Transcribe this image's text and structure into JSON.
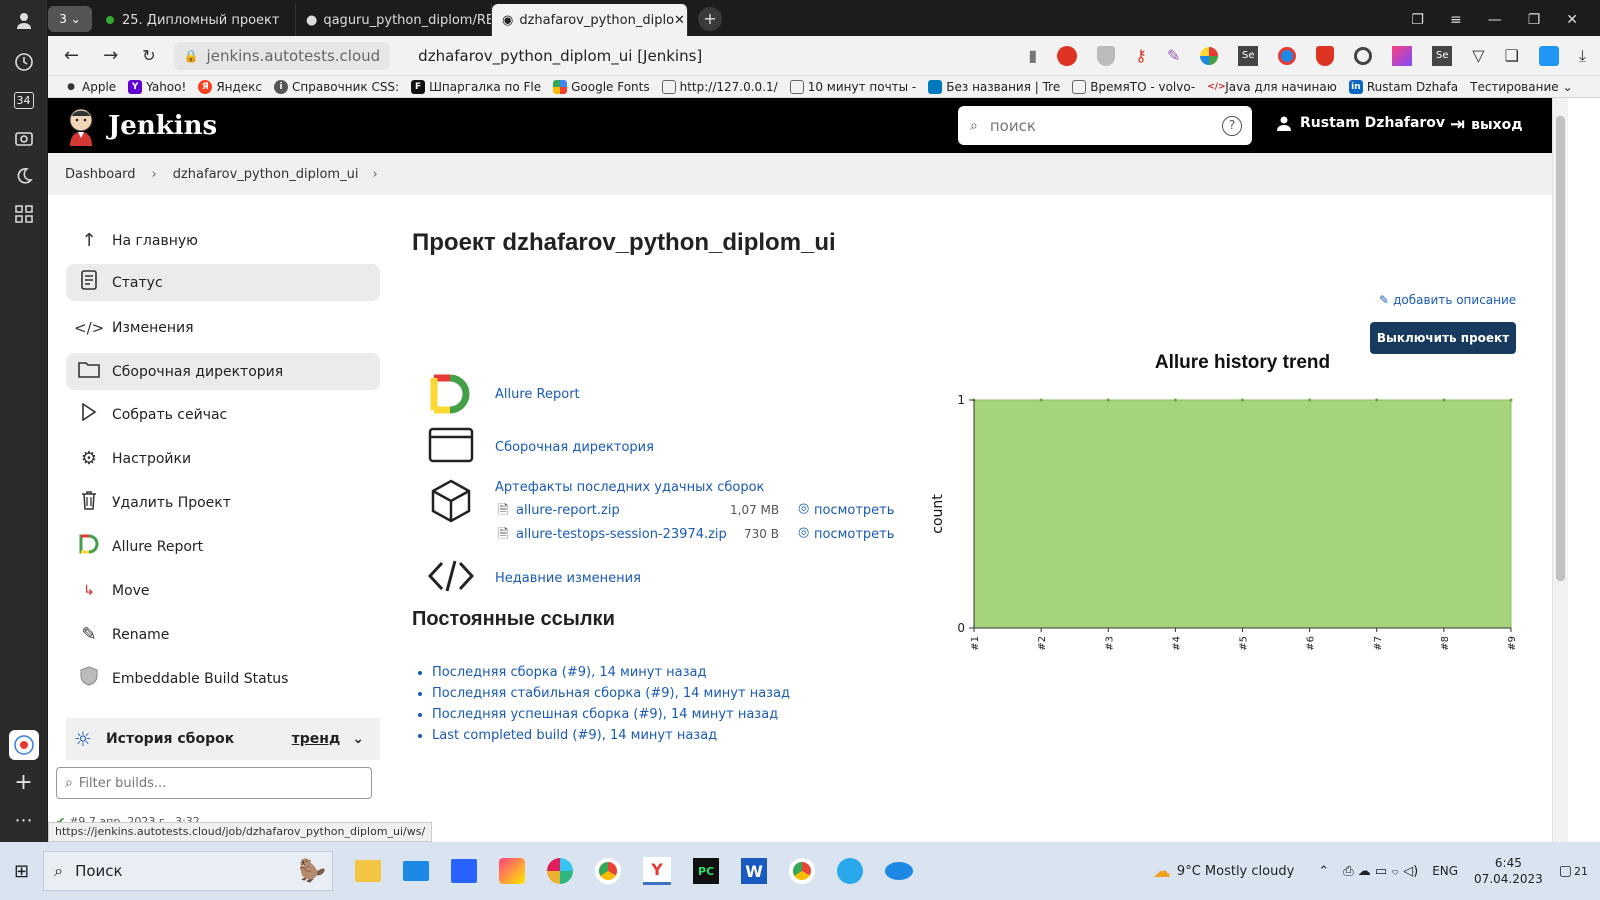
{
  "browser": {
    "sidebar_badge": "34",
    "tabs": [
      {
        "label": "3"
      },
      {
        "label": "25. Дипломный проект"
      },
      {
        "label": "qaguru_python_diplom/RE"
      },
      {
        "label": "dzhafarov_python_diplo"
      }
    ],
    "address_domain": "jenkins.autotests.cloud",
    "page_title": "dzhafarov_python_diplom_ui [Jenkins]",
    "bookmarks": [
      "Apple",
      "Yahoo!",
      "Яндекс",
      "Справочник CSS:",
      "Шпаргалка по Fle",
      "Google Fonts",
      "http://127.0.0.1/",
      "10 минут почты -",
      "Без названия | Tre",
      "ВремяТО - volvo-",
      "Java для начинаю",
      "Rustam Dzhafa",
      "Тестирование"
    ],
    "status_url": "https://jenkins.autotests.cloud/job/dzhafarov_python_diplom_ui/ws/"
  },
  "header": {
    "brand": "Jenkins",
    "search_placeholder": "поиск",
    "user": "Rustam Dzhafarov",
    "logout": "выход"
  },
  "breadcrumb": [
    "Dashboard",
    "dzhafarov_python_diplom_ui"
  ],
  "sidebar": {
    "items": [
      {
        "label": "На главную",
        "icon": "arrow-up-icon"
      },
      {
        "label": "Статус",
        "icon": "document-icon"
      },
      {
        "label": "Изменения",
        "icon": "code-icon"
      },
      {
        "label": "Сборочная директория",
        "icon": "folder-icon"
      },
      {
        "label": "Собрать сейчас",
        "icon": "play-icon"
      },
      {
        "label": "Настройки",
        "icon": "gear-icon"
      },
      {
        "label": "Удалить Проект",
        "icon": "trash-icon"
      },
      {
        "label": "Allure Report",
        "icon": "allure-icon"
      },
      {
        "label": "Move",
        "icon": "move-icon"
      },
      {
        "label": "Rename",
        "icon": "pencil-icon"
      },
      {
        "label": "Embeddable Build Status",
        "icon": "shield-icon"
      }
    ],
    "history_title": "История сборок",
    "trend_label": "тренд",
    "filter_placeholder": "Filter builds...",
    "build_row_partial": "#9       7 апр. 2023 г., 3:32"
  },
  "main": {
    "title": "Проект dzhafarov_python_diplom_ui",
    "add_description": "добавить описание",
    "disable_button": "Выключить проект",
    "links": {
      "allure": "Allure Report",
      "workspace": "Сборочная директория",
      "artifacts": "Артефакты последних удачных сборок",
      "recent_changes": "Недавние изменения"
    },
    "artifacts": [
      {
        "name": "allure-report.zip",
        "size": "1,07 MB",
        "view": "посмотреть"
      },
      {
        "name": "allure-testops-session-23974.zip",
        "size": "730 B",
        "view": "посмотреть"
      }
    ],
    "permalinks_title": "Постоянные ссылки",
    "permalinks": [
      "Последняя сборка (#9), 14 минут назад",
      "Последняя стабильная сборка (#9), 14 минут назад",
      "Последняя успешная сборка (#9), 14 минут назад",
      "Last completed build (#9), 14 минут назад"
    ]
  },
  "chart_data": {
    "type": "area",
    "title": "Allure history trend",
    "xlabel": "",
    "ylabel": "count",
    "categories": [
      "#1",
      "#2",
      "#3",
      "#4",
      "#5",
      "#6",
      "#7",
      "#8",
      "#9"
    ],
    "series": [
      {
        "values": [
          1,
          1,
          1,
          1,
          1,
          1,
          1,
          1,
          1
        ],
        "color": "#a5d47a"
      }
    ],
    "ylim": [
      0,
      1
    ],
    "yticks": [
      "1",
      "0"
    ]
  },
  "taskbar": {
    "search": "Поиск",
    "weather": "9°C  Mostly cloudy",
    "lang": "ENG",
    "time": "6:45",
    "date": "07.04.2023",
    "notif": "21"
  },
  "colors": {
    "accent": "#1a5ab4",
    "button_bg": "#173a5e",
    "chart_fill": "#a5d47a"
  }
}
